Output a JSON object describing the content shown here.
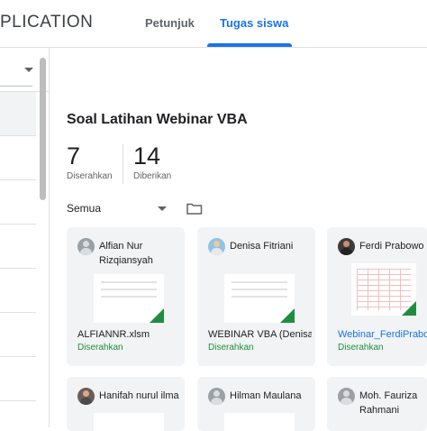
{
  "header": {
    "app_title": "PLICATION",
    "tabs": [
      {
        "label": "Petunjuk",
        "active": false
      },
      {
        "label": "Tugas siswa",
        "active": true
      }
    ],
    "accent_color": "#1a73e8"
  },
  "assignment": {
    "title": "Soal Latihan Webinar VBA",
    "stats": [
      {
        "value": "7",
        "label": "Diserahkan"
      },
      {
        "value": "14",
        "label": "Diberikan"
      }
    ],
    "filter": {
      "selected": "Semua"
    },
    "folder_icon": "folder-icon"
  },
  "students": [
    {
      "name": "Alfian Nur Rizqiansyah",
      "file": "ALFIANNR.xlsm",
      "status": "Diserahkan"
    },
    {
      "name": "Denisa Fitriani",
      "file": "WEBINAR VBA (Denisa Fitriani)",
      "status": "Diserahkan"
    },
    {
      "name": "Ferdi Prabowo",
      "file": "Webinar_FerdiPrabowo",
      "status": "Diserahkan"
    },
    {
      "name": "Hanifah nurul ilma",
      "file": "",
      "status": ""
    },
    {
      "name": "Hilman Maulana",
      "file": "",
      "status": ""
    },
    {
      "name": "Moh. Fauriza Rahmani",
      "file": "",
      "status": ""
    }
  ],
  "status_color": "#1e8e3e"
}
